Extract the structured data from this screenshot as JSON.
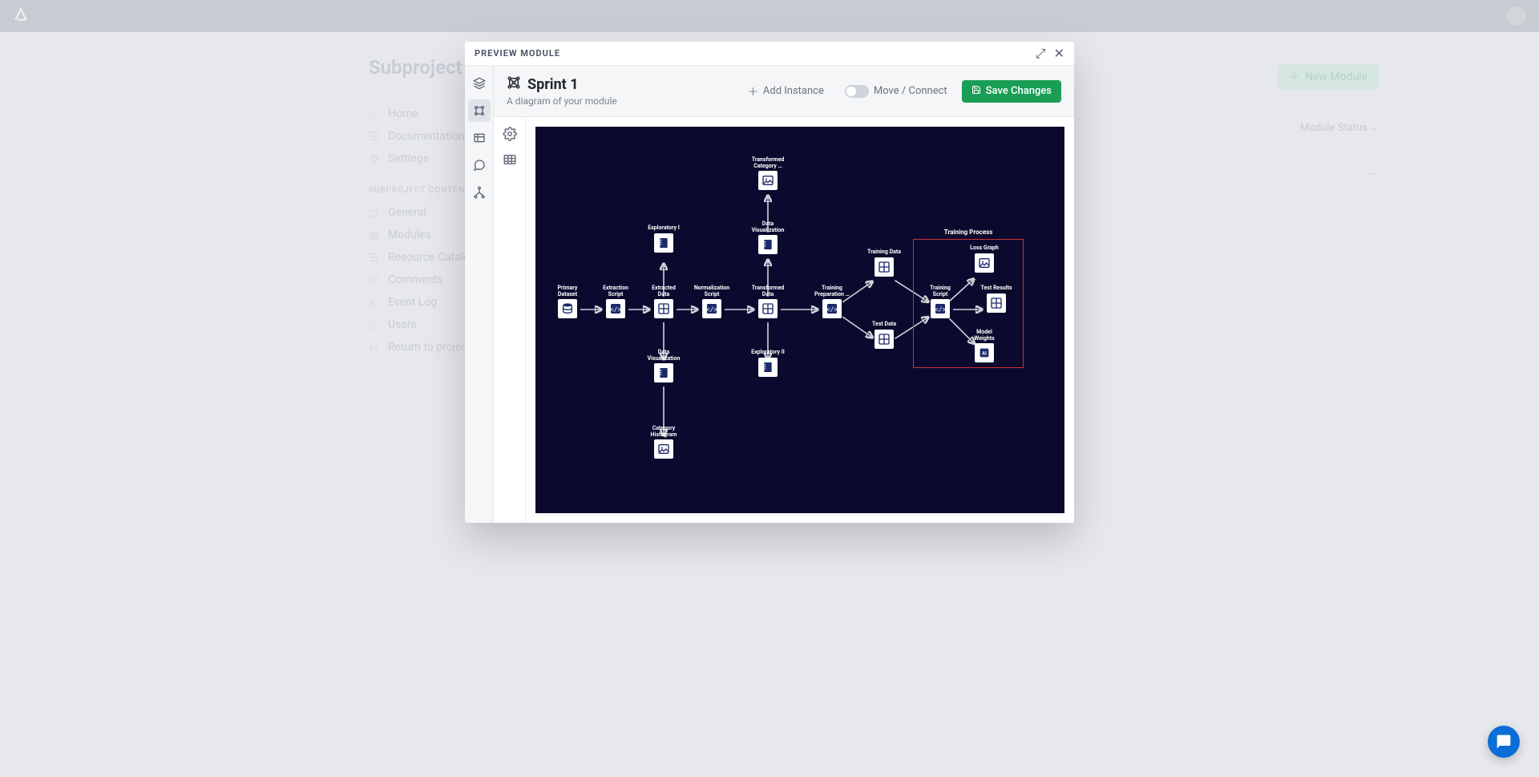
{
  "topbar": {
    "logo_glyph": "◿"
  },
  "bg": {
    "title": "Subproject",
    "new_module": "New Module",
    "module_status": "Module Status",
    "nav_primary": [
      {
        "label": "Home"
      },
      {
        "label": "Documentation"
      },
      {
        "label": "Settings"
      }
    ],
    "section_label": "SUBPROJECT CONTENT",
    "nav_secondary": [
      {
        "label": "General"
      },
      {
        "label": "Modules"
      },
      {
        "label": "Resource Catalog"
      },
      {
        "label": "Comments"
      },
      {
        "label": "Event Log"
      },
      {
        "label": "Users"
      },
      {
        "label": "Return to project"
      }
    ]
  },
  "modal": {
    "header_label": "PREVIEW MODULE",
    "title": "Sprint 1",
    "subtitle": "A diagram of your module",
    "add_instance": "Add Instance",
    "move_connect": "Move / Connect",
    "save_changes": "Save Changes"
  },
  "diagram": {
    "group": {
      "label": "Training Process"
    },
    "nodes": {
      "primary_dataset": {
        "label": "Primary\nDataset",
        "icon": "db"
      },
      "extraction_script": {
        "label": "Extraction\nScript",
        "icon": "code"
      },
      "extracted_data": {
        "label": "Extracted\nData",
        "icon": "grid"
      },
      "exploratory1": {
        "label": "Exploratory I",
        "icon": "notebook"
      },
      "normalization": {
        "label": "Normalization\nScript",
        "icon": "code"
      },
      "transformed_data": {
        "label": "Transformed\nData",
        "icon": "grid"
      },
      "transformed_cat": {
        "label": "Transformed\nCategory …",
        "icon": "image"
      },
      "data_viz_top": {
        "label": "Data\nVisualization",
        "icon": "notebook"
      },
      "training_prep": {
        "label": "Training\nPreparation …",
        "icon": "code"
      },
      "training_data": {
        "label": "Training Data",
        "icon": "grid"
      },
      "test_data": {
        "label": "Test Data",
        "icon": "grid"
      },
      "training_script": {
        "label": "Training\nScript",
        "icon": "code"
      },
      "loss_graph": {
        "label": "Loss Graph",
        "icon": "image"
      },
      "test_results": {
        "label": "Test Results",
        "icon": "grid"
      },
      "model_weights": {
        "label": "Model\nWeights",
        "icon": "ai"
      },
      "data_viz_bot": {
        "label": "Data\nVisualization",
        "icon": "notebook"
      },
      "cat_histogram": {
        "label": "Category\nHistogram",
        "icon": "image"
      },
      "exploratory2": {
        "label": "Exploratory II",
        "icon": "notebook"
      }
    }
  }
}
